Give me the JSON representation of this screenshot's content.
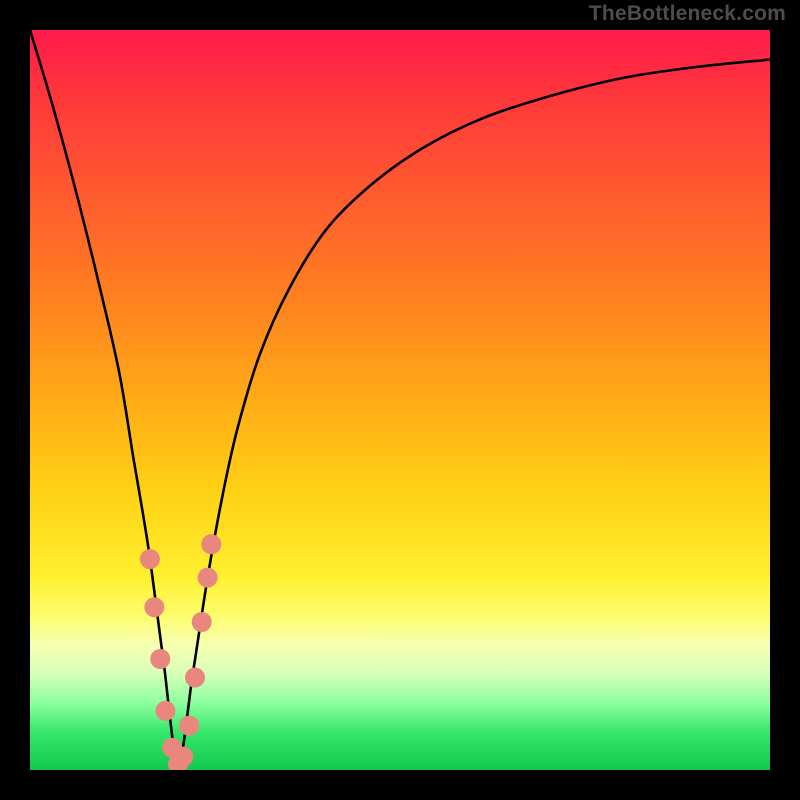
{
  "watermark": {
    "text": "TheBottleneck.com"
  },
  "colors": {
    "curve_stroke": "#000000",
    "marker_fill": "#e9877f",
    "marker_stroke": "#c06058",
    "frame": "#000000"
  },
  "chart_data": {
    "type": "line",
    "title": "",
    "xlabel": "",
    "ylabel": "",
    "xlim": [
      0,
      100
    ],
    "ylim": [
      0,
      100
    ],
    "grid": false,
    "legend": false,
    "note": "V-shaped bottleneck curve; axes unlabeled in source. x ≈ relative GPU/CPU capability; y ≈ bottleneck %. Minimum near x≈20, y≈0. Values estimated from pixels.",
    "series": [
      {
        "name": "bottleneck-curve",
        "x": [
          0,
          3,
          6,
          9,
          12,
          14,
          16,
          18,
          20,
          22,
          24,
          26,
          28,
          31,
          35,
          40,
          46,
          53,
          61,
          70,
          80,
          90,
          100
        ],
        "y": [
          100,
          90,
          79,
          67,
          54,
          42,
          30,
          15,
          1,
          13,
          26,
          37,
          46,
          56,
          65,
          73,
          79,
          84,
          88,
          91,
          93.5,
          95,
          96
        ]
      }
    ],
    "markers": {
      "name": "highlight-points",
      "x": [
        16.2,
        16.8,
        17.6,
        18.3,
        19.2,
        20.0,
        20.7,
        21.5,
        22.3,
        23.2,
        24.0,
        24.5
      ],
      "y": [
        28.5,
        22.0,
        15.0,
        8.0,
        3.0,
        0.8,
        1.8,
        6.0,
        12.5,
        20.0,
        26.0,
        30.5
      ]
    }
  }
}
